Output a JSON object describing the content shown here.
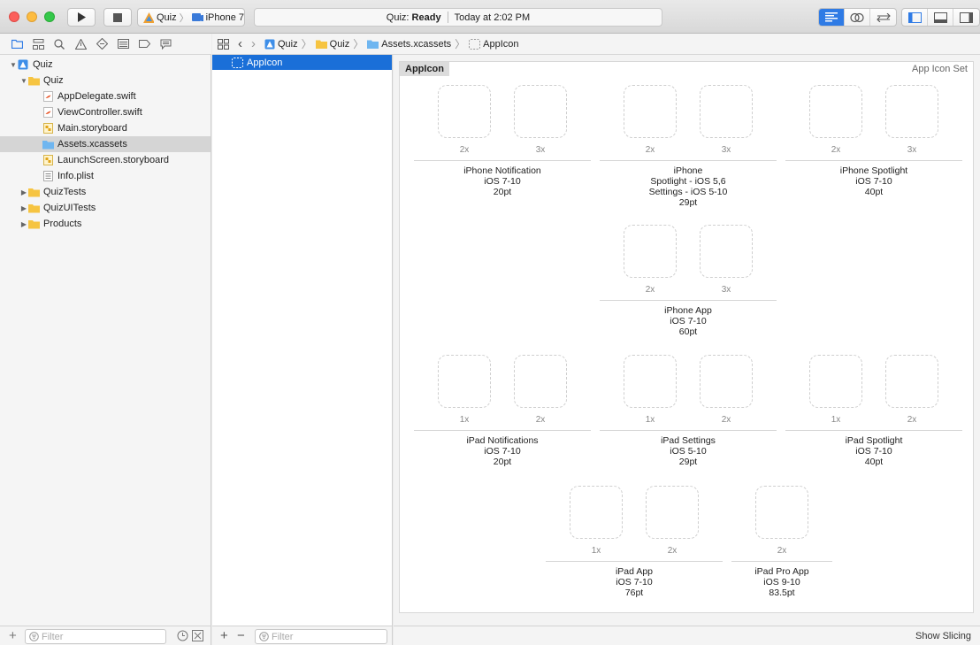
{
  "toolbar": {
    "scheme": {
      "project": "Quiz",
      "device": "iPhone 7"
    },
    "status": {
      "project": "Quiz:",
      "state": "Ready",
      "time": "Today at 2:02 PM"
    }
  },
  "navigator": {
    "items": [
      {
        "label": "Quiz",
        "icon": "project-icon",
        "level": 0,
        "disclosure": "open"
      },
      {
        "label": "Quiz",
        "icon": "folder-icon",
        "level": 1,
        "disclosure": "open"
      },
      {
        "label": "AppDelegate.swift",
        "icon": "swift-file-icon",
        "level": 2
      },
      {
        "label": "ViewController.swift",
        "icon": "swift-file-icon",
        "level": 2
      },
      {
        "label": "Main.storyboard",
        "icon": "storyboard-icon",
        "level": 2
      },
      {
        "label": "Assets.xcassets",
        "icon": "asset-catalog-icon",
        "level": 2,
        "selected": true
      },
      {
        "label": "LaunchScreen.storyboard",
        "icon": "storyboard-icon",
        "level": 2
      },
      {
        "label": "Info.plist",
        "icon": "plist-icon",
        "level": 2
      },
      {
        "label": "QuizTests",
        "icon": "folder-icon",
        "level": 1,
        "disclosure": "closed"
      },
      {
        "label": "QuizUITests",
        "icon": "folder-icon",
        "level": 1,
        "disclosure": "closed"
      },
      {
        "label": "Products",
        "icon": "folder-icon",
        "level": 1,
        "disclosure": "closed"
      }
    ],
    "filter_placeholder": "Filter"
  },
  "jumpbar": {
    "crumbs": [
      "Quiz",
      "Quiz",
      "Assets.xcassets",
      "AppIcon"
    ]
  },
  "asset_list": {
    "items": [
      "AppIcon"
    ],
    "filter_placeholder": "Filter"
  },
  "canvas": {
    "set_name": "AppIcon",
    "set_type": "App Icon Set",
    "groups": [
      {
        "scales": [
          "2x",
          "3x"
        ],
        "label": [
          "iPhone Notification",
          "iOS 7-10",
          "20pt"
        ]
      },
      {
        "scales": [
          "2x",
          "3x"
        ],
        "label": [
          "iPhone",
          "Spotlight - iOS 5,6",
          "Settings - iOS 5-10",
          "29pt"
        ]
      },
      {
        "scales": [
          "2x",
          "3x"
        ],
        "label": [
          "iPhone Spotlight",
          "iOS 7-10",
          "40pt"
        ]
      },
      {
        "scales": [
          "2x",
          "3x"
        ],
        "label": [
          "iPhone App",
          "iOS 7-10",
          "60pt"
        ]
      },
      {
        "scales": [
          "1x",
          "2x"
        ],
        "label": [
          "iPad Notifications",
          "iOS 7-10",
          "20pt"
        ]
      },
      {
        "scales": [
          "1x",
          "2x"
        ],
        "label": [
          "iPad Settings",
          "iOS 5-10",
          "29pt"
        ]
      },
      {
        "scales": [
          "1x",
          "2x"
        ],
        "label": [
          "iPad Spotlight",
          "iOS 7-10",
          "40pt"
        ]
      },
      {
        "scales": [
          "1x",
          "2x"
        ],
        "label": [
          "iPad App",
          "iOS 7-10",
          "76pt"
        ]
      },
      {
        "scales": [
          "2x"
        ],
        "label": [
          "iPad Pro App",
          "iOS 9-10",
          "83.5pt"
        ]
      }
    ],
    "show_slicing": "Show Slicing"
  },
  "colors": {
    "accent": "#1a6fd8",
    "folder": "#f6c441"
  }
}
